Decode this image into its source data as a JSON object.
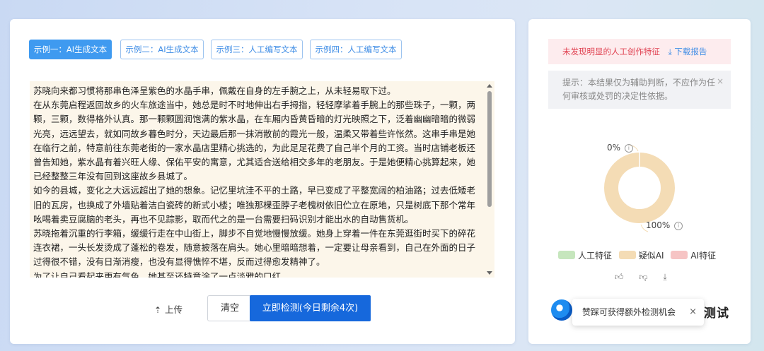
{
  "tabs": [
    {
      "label": "示例一：AI生成文本",
      "active": true
    },
    {
      "label": "示例二：AI生成文本",
      "active": false
    },
    {
      "label": "示例三：人工编写文本",
      "active": false
    },
    {
      "label": "示例四：人工编写文本",
      "active": false
    }
  ],
  "editor": {
    "paragraphs": [
      "苏晓向来都习惯将那串色泽呈紫色的水晶手串，佩戴在自身的左手腕之上，从未轻易取下过。",
      "在从东莞启程返回故乡的火车旅途当中，她总是时不时地伸出右手拇指，轻轻摩挲着手腕上的那些珠子，一颗，两颗，三颗，数得格外认真。那一颗颗圆润饱满的紫水晶，在车厢内昏黄昏暗的灯光映照之下，泛着幽幽暗暗的微弱光亮，远远望去，就如同故乡暮色时分，天边最后那一抹消散前的霞光一般，温柔又带着些许怅然。这串手串是她在临行之前，特意前往东莞老街的一家水晶店里精心挑选的，为此足足花费了自己半个月的工资。当时店铺老板还曾告知她，紫水晶有着兴旺人缘、保佑平安的寓意，尤其适合送给相交多年的老朋友。于是她便精心挑算起来，她已经整整三年没有回到这座故乡县城了。",
      "如今的县城，变化之大远远超出了她的想象。记忆里坑洼不平的土路，早已变成了平整宽阔的柏油路；过去低矮老旧的瓦房，也换成了外墙贴着洁白瓷砖的新式小楼；唯独那棵歪脖子老槐树依旧伫立在原地，只是树底下那个常年吆喝着卖豆腐脑的老头，再也不见踪影，取而代之的是一台需要扫码识别才能出水的自动售货机。",
      "苏晓拖着沉重的行李箱，缓缓行走在中山街上，脚步不自觉地慢慢放缓。她身上穿着一件在东莞逛街时买下的碎花连衣裙，一头长发烫成了蓬松的卷发，随意披落在肩头。她心里暗暗想着，一定要让母亲看到，自己在外面的日子过得很不错，没有日渐消瘦，也没有显得憔悴不堪，反而过得愈发精神了。",
      "为了让自己看起来更有气色，她甚至还特意涂了一点淡雅的口红。"
    ]
  },
  "actions": {
    "upload_label": "上传",
    "clear_label": "清空",
    "detect_label": "立即检测(今日剩余4次)"
  },
  "result": {
    "banner_text": "未发现明显的人工创作特征",
    "download_label": "下载报告",
    "notice_text": "提示：本结果仅为辅助判断，不应作为任何审核或处罚的决定性依据。",
    "notice_close": "×"
  },
  "chart_data": {
    "type": "pie",
    "donut": true,
    "slices": [
      {
        "label": "人工特征",
        "value": 0,
        "color": "#c6e6bd"
      },
      {
        "label": "疑似AI",
        "value": 100,
        "color": "#f4dcb5"
      },
      {
        "label": "AI特征",
        "value": 0,
        "color": "#f6c4c4"
      }
    ],
    "annotations": [
      {
        "text": "0%",
        "slice": "AI特征"
      },
      {
        "text": "100%",
        "slice": "疑似AI"
      }
    ]
  },
  "legend": [
    {
      "label": "人工特征",
      "color": "#c6e6bd"
    },
    {
      "label": "疑似AI",
      "color": "#f4dcb5"
    },
    {
      "label": "AI特征",
      "color": "#f6c4c4"
    }
  ],
  "feedback": {
    "like_icon": "thumbs-up-icon",
    "dislike_icon": "thumbs-down-icon",
    "download_icon": "download-icon"
  },
  "promo": {
    "brand_suffix": "测试",
    "toast_text": "赞踩可获得额外检测机会",
    "toast_close": "×"
  }
}
